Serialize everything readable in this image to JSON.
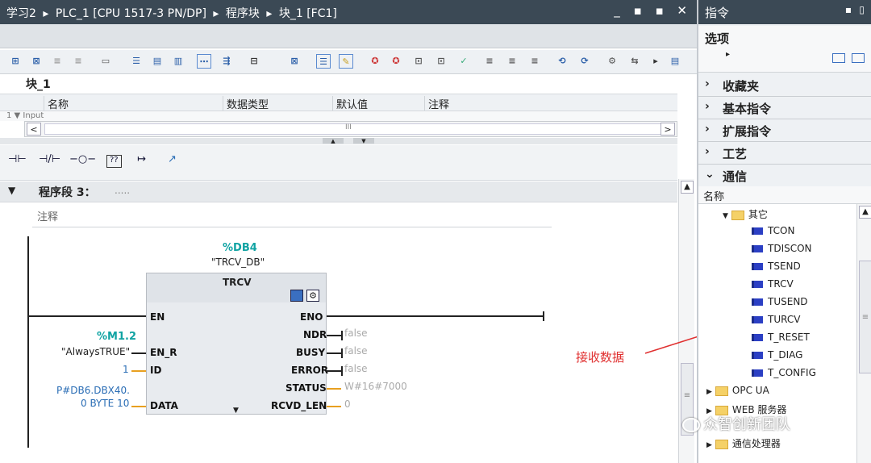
{
  "title_bar": {
    "crumbs": [
      "学习2",
      "▸",
      "PLC_1 [CPU 1517-3 PN/DP]",
      "▸",
      "程序块",
      "▸",
      "块_1 [FC1]"
    ],
    "win_buttons": "_ ▪ ▪ ✕"
  },
  "block_name": "块_1",
  "interface": {
    "columns": [
      "名称",
      "数据类型",
      "默认值",
      "注释"
    ],
    "row1": "1  ▼ Input",
    "scroll_mid": "III"
  },
  "ladder_toolbar": [
    "⊣⊢",
    "⊣/⊢",
    "−○−",
    "??",
    "↦",
    "↗"
  ],
  "network": {
    "label": "程序段 3：",
    "dots": ".....",
    "comment": "注释"
  },
  "block": {
    "db_addr": "%DB4",
    "db_name": "\"TRCV_DB\"",
    "type": "TRCV",
    "inputs": [
      "EN",
      "EN_R",
      "ID",
      "DATA"
    ],
    "outputs": [
      "ENO",
      "NDR",
      "BUSY",
      "ERROR",
      "STATUS",
      "RCVD_LEN"
    ],
    "en_r_addr": "%M1.2",
    "en_r_name": "\"AlwaysTRUE\"",
    "id_value": "1",
    "data_value_1": "P#DB6.DBX40.",
    "data_value_2": "0 BYTE 10",
    "ndr_val": "false",
    "busy_val": "false",
    "error_val": "false",
    "status_val": "W#16#7000",
    "rcvd_val": "0"
  },
  "annotation": "接收数据",
  "panel": {
    "title": "指令",
    "options": "选项",
    "sections": [
      "收藏夹",
      "基本指令",
      "扩展指令",
      "工艺",
      "通信"
    ],
    "name_header": "名称",
    "folder_other": "其它",
    "items": [
      "TCON",
      "TDISCON",
      "TSEND",
      "TRCV",
      "TUSEND",
      "TURCV",
      "T_RESET",
      "T_DIAG",
      "T_CONFIG"
    ],
    "folders": [
      "OPC UA",
      "WEB 服务器",
      "通信处理器"
    ]
  },
  "watermark": "众智创新团队"
}
